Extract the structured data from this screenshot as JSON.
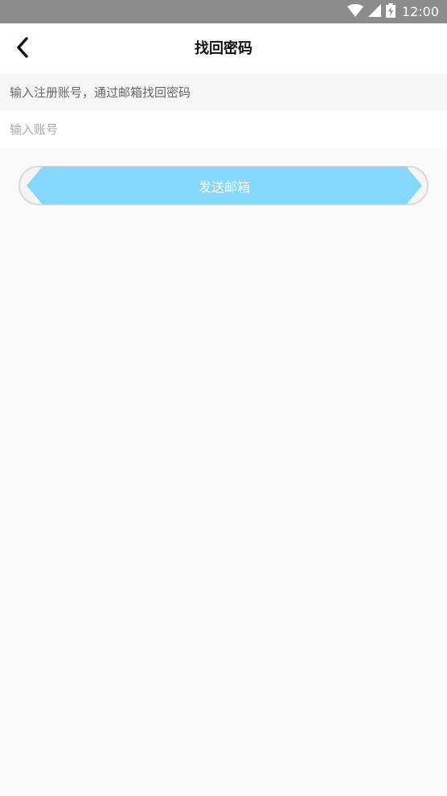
{
  "status_bar": {
    "time": "12:00",
    "icons": [
      "wifi-icon",
      "signal-icon",
      "battery-icon"
    ]
  },
  "nav": {
    "title": "找回密码",
    "back_icon": "chevron-left-icon"
  },
  "form": {
    "hint": "输入注册账号，通过邮箱找回密码",
    "account_placeholder": "输入账号",
    "account_value": "",
    "submit_label": "发送邮箱"
  },
  "colors": {
    "status_bar": "#8c8c8c",
    "button": "#84d8fe",
    "background": "#f9f9f9"
  }
}
